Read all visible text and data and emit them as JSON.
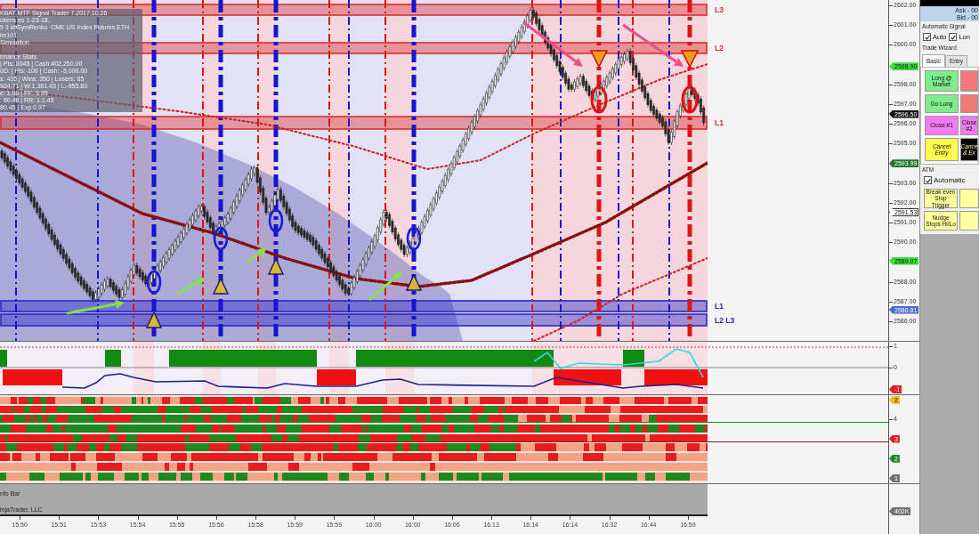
{
  "chart": {
    "info_header": [
      "KBAT MTF Signal Trader 7.2017.10.26",
      "ckens es 1-23-18..",
      "5 3 kbSymRenko  CME US Index Futures ETH",
      "im101",
      "Simulation"
    ],
    "performance_stats": [
      "rmance Stats",
      "| Pts: 8045 | Cash:402,250.00",
      "0D: | Pts:-100 | Cash: -5,000.00",
      "s: 435 | Wins: 350 | Losers: 85",
      "924.71 | W:1,381.43 | L:-955.83",
      "e: 1.00 | PF: 5.95",
      ": 80.46 | RR: 1:1.45",
      "80.45 | Exp:0.97"
    ],
    "zones": [
      {
        "label": "L3",
        "color": "#d83030"
      },
      {
        "label": "L2",
        "color": "#d83030"
      },
      {
        "label": "L1",
        "color": "#d83030"
      },
      {
        "label": "L1",
        "color": "#2828c8"
      },
      {
        "label": "L2 L3",
        "color": "#2828c8"
      }
    ],
    "price_axis": [
      {
        "kind": "tick",
        "text": "2602.00"
      },
      {
        "kind": "tick",
        "text": "2601.00"
      },
      {
        "kind": "tick",
        "text": "2600.00"
      },
      {
        "kind": "tag",
        "text": "2598.90",
        "color": "#3ee03e"
      },
      {
        "kind": "tick",
        "text": "2598.00"
      },
      {
        "kind": "tick",
        "text": "2597.00"
      },
      {
        "kind": "tag",
        "text": "2596.50",
        "color": "#111111"
      },
      {
        "kind": "tick",
        "text": "2596.00"
      },
      {
        "kind": "tick",
        "text": "2595.00"
      },
      {
        "kind": "tag",
        "text": "2593.99",
        "color": "#1e7a2a"
      },
      {
        "kind": "tick",
        "text": "2593.00"
      },
      {
        "kind": "tick",
        "text": "2592.00"
      },
      {
        "kind": "tag",
        "text": "2591.53",
        "color": "#ffffff"
      },
      {
        "kind": "tick",
        "text": "2591.00"
      },
      {
        "kind": "tick",
        "text": "2590.00"
      },
      {
        "kind": "tag",
        "text": "2589.07",
        "color": "#3ee03e"
      },
      {
        "kind": "tick",
        "text": "2588.00"
      },
      {
        "kind": "tick",
        "text": "2587.00"
      },
      {
        "kind": "tag",
        "text": "2586.81",
        "color": "#4a6cd0"
      },
      {
        "kind": "tick",
        "text": "2586.00"
      }
    ]
  },
  "oscillator": {
    "axis": [
      {
        "kind": "tick",
        "text": "1"
      },
      {
        "kind": "tick",
        "text": "0"
      },
      {
        "kind": "tag",
        "text": "-1",
        "color": "#e02020"
      }
    ]
  },
  "heatmap": {
    "axis": [
      {
        "kind": "tag",
        "text": "2",
        "color": "#e8c020"
      },
      {
        "kind": "tick",
        "text": "4"
      },
      {
        "kind": "tag",
        "text": "3",
        "color": "#e02020"
      },
      {
        "kind": "tag",
        "text": "2",
        "color": "#1a8a2a"
      },
      {
        "kind": "tag",
        "text": "1",
        "color": "#707070"
      }
    ]
  },
  "info_bar": {
    "texts": [
      "nfo Bar",
      "injaTrader, LLC"
    ],
    "axis": [
      {
        "kind": "tag",
        "text": "402K",
        "color": "#707070"
      }
    ]
  },
  "time_axis": [
    "15:50",
    "15:51",
    "15:53",
    "15:54",
    "15:55",
    "15:56",
    "15:58",
    "15:59",
    "15:59",
    "16:00",
    "16:00",
    "16:06",
    "16:13",
    "16:14",
    "16:14",
    "16:32",
    "16:44",
    "16:59"
  ],
  "side_panel": {
    "quote": [
      "Ask - 00",
      "Bid - 00"
    ],
    "signal_title": "Automatic Signal",
    "signal_options": [
      {
        "label": "Auto",
        "checked": true
      },
      {
        "label": "Lon",
        "checked": true
      }
    ],
    "wizard_title": "Trade Wizard",
    "tabs": [
      {
        "label": "Basic",
        "selected": true
      },
      {
        "label": "Entry",
        "selected": false
      }
    ],
    "trade_buttons": [
      {
        "kind": "order",
        "label": "Long @ Market",
        "color": "#80ec8c"
      },
      {
        "kind": "order",
        "color": "#f27878"
      },
      {
        "kind": "order",
        "label": "Go Long",
        "color": "#80ec8c"
      },
      {
        "kind": "order",
        "color": "#f27878"
      },
      {
        "kind": "order",
        "label": "Close #1",
        "color": "#f07cf0"
      },
      {
        "kind": "order",
        "label": "Close #2",
        "color": "#f07cf0"
      },
      {
        "kind": "cancel",
        "label": "Cancel Entry",
        "color": "#ffff50"
      },
      {
        "kind": "cancel",
        "label": "Cance & Ex",
        "color": "#000000"
      }
    ],
    "atm_title": "ATM",
    "atm_option": {
      "label": "Automatic",
      "checked": true
    },
    "atm_buttons": [
      {
        "kind": "order",
        "label": "Break even Stop Trigger",
        "color": "#ffffa0"
      },
      {
        "kind": "order",
        "color": "#ffffa0"
      },
      {
        "kind": "order",
        "label": "Nudge Stops Hi/Lo",
        "color": "#ffffa0"
      },
      {
        "kind": "order",
        "color": "#ffffa0"
      }
    ]
  }
}
